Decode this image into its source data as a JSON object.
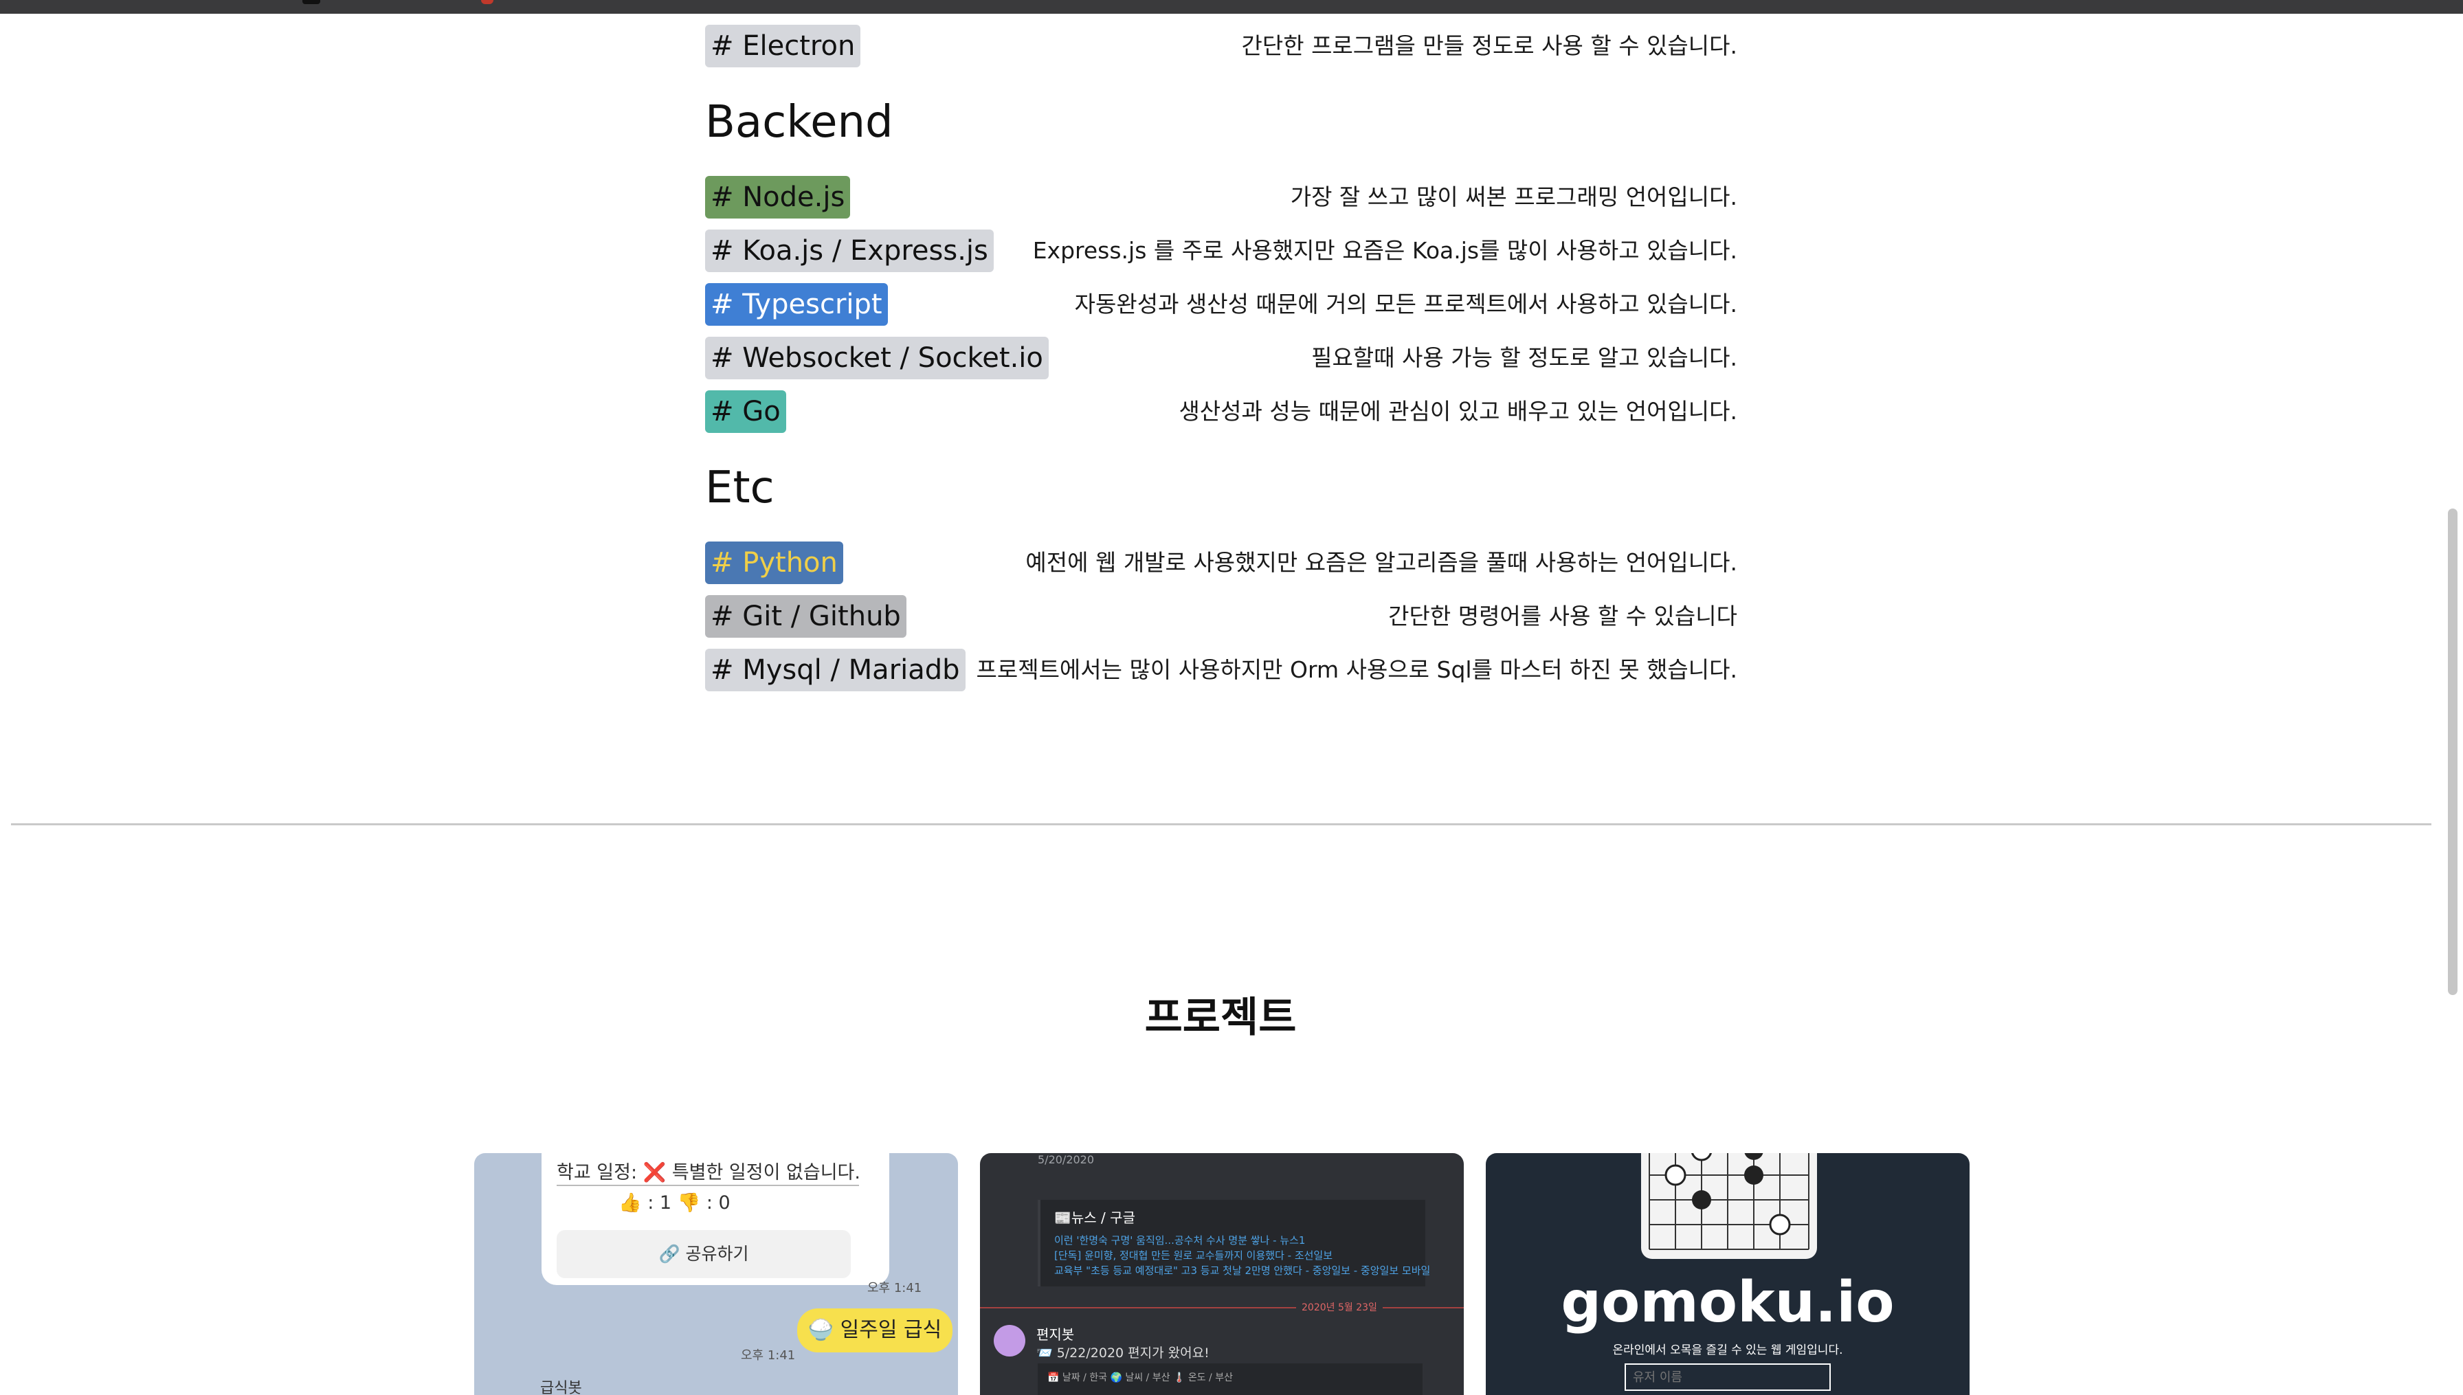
{
  "frontend_tail": [
    {
      "tag": "# Electron",
      "desc": "간단한 프로그램을 만들 정도로 사용 할 수 있습니다."
    }
  ],
  "backend": {
    "title": "Backend",
    "items": [
      {
        "tag": "# Node.js",
        "desc": "가장 잘 쓰고 많이 써본 프로그래밍 언어입니다."
      },
      {
        "tag": "# Koa.js / Express.js",
        "desc": "Express.js 를 주로 사용했지만 요즘은 Koa.js를 많이 사용하고 있습니다."
      },
      {
        "tag": "# Typescript",
        "desc": "자동완성과 생산성 때문에 거의 모든 프로젝트에서 사용하고 있습니다."
      },
      {
        "tag": "# Websocket / Socket.io",
        "desc": "필요할때 사용 가능 할 정도로 알고 있습니다."
      },
      {
        "tag": "# Go",
        "desc": "생산성과 성능 때문에 관심이 있고 배우고 있는 언어입니다."
      }
    ]
  },
  "etc": {
    "title": "Etc",
    "items": [
      {
        "tag": "# Python",
        "desc": "예전에 웹 개발로 사용했지만 요즘은 알고리즘을 풀때 사용하는 언어입니다."
      },
      {
        "tag": "# Git / Github",
        "desc": "간단한 명령어를 사용 할 수 있습니다"
      },
      {
        "tag": "# Mysql / Mariadb",
        "desc": "프로젝트에서는 많이 사용하지만 Orm 사용으로 Sql를 마스터 하진 못 했습니다."
      }
    ]
  },
  "projects": {
    "title": "프로젝트",
    "card1": {
      "line1": "학교 일정: ❌ 특별한 일정이 없습니다.",
      "reactions": "👍 : 1      👎 : 0",
      "share": "🔗 공유하기",
      "time1": "오후 1:41",
      "button": "🍚 일주일 급식",
      "time2": "오후 1:41",
      "bot": "급식봇"
    },
    "card2": {
      "top": "5/20/2020",
      "embed_title": "📰뉴스 / 구글",
      "embed_l1": "이런 '한명숙 구명' 움직임...공수처 수사 명분 쌓나 - 뉴스1",
      "embed_l2": "[단독] 윤미향, 정대협 만든 원로 교수들까지 이용했다 - 조선일보",
      "embed_l3": "교육부 \"초등 등교 예정대로\" 고3 등교 첫날 2만명 안했다 - 중앙일보 - 중앙일보 모바일",
      "date": "2020년 5월 23일",
      "name": "편지봇",
      "msg": "📨 5/22/2020 편지가 왔어요!",
      "embed2": "📅 날짜 / 한국    🌍 날씨 / 부산    🌡️ 온도 / 부산"
    },
    "card3": {
      "title": "gomoku.io",
      "subtitle": "온라인에서 오목을 즐길 수 있는 웹 게임입니다.",
      "input_placeholder": "유저 이름"
    }
  },
  "colors": {
    "tag_gray": "#d5d7dc",
    "tag_node": "#6d9a5d",
    "tag_typescript": "#3f7fd4",
    "tag_go": "#52b9aa",
    "tag_python_bg": "#4a78b3",
    "tag_python_text": "#f0cf48"
  }
}
